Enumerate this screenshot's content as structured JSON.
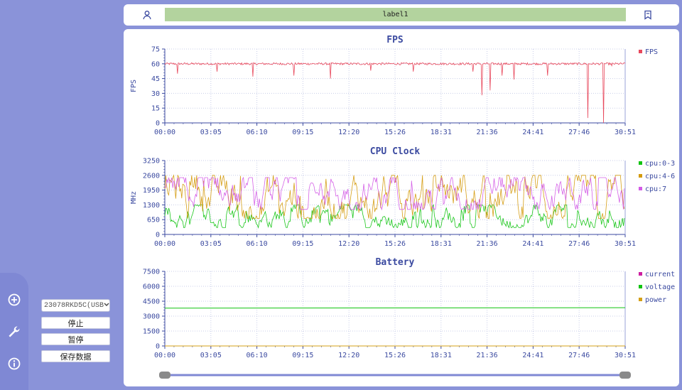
{
  "toolbar": {
    "label": "label1"
  },
  "sidebar": {
    "device": "23078RKD5C(USB",
    "stop": "停止",
    "pause": "暂停",
    "save": "保存数据",
    "icons": [
      "plus-circle-icon",
      "wrench-icon",
      "info-icon"
    ]
  },
  "colors": {
    "background": "#8a93d9",
    "fps": "#e8485c",
    "cpu_0_3": "#10c410",
    "cpu_4_6": "#d49a0c",
    "cpu_7": "#d35be6",
    "current": "#cc1fa0",
    "voltage": "#10c410",
    "power": "#d4a017",
    "title": "#3b4aa0"
  },
  "chart_data": [
    {
      "type": "line",
      "title": "FPS",
      "ylabel": "FPS",
      "ylim": [
        0,
        75
      ],
      "yticks": [
        "0",
        "15",
        "30",
        "45",
        "60",
        "75"
      ],
      "xticks": [
        "00:00",
        "03:05",
        "06:10",
        "09:15",
        "12:20",
        "15:26",
        "18:31",
        "21:36",
        "24:41",
        "27:46",
        "30:51"
      ],
      "xlim_seconds": [
        0,
        1851
      ],
      "grid": true,
      "legend": "right",
      "series": [
        {
          "name": "FPS",
          "baseline": 60,
          "dips": [
            [
              50,
              50
            ],
            [
              210,
              52
            ],
            [
              355,
              47
            ],
            [
              520,
              48
            ],
            [
              665,
              45
            ],
            [
              828,
              53
            ],
            [
              1000,
              52
            ],
            [
              1238,
              52
            ],
            [
              1276,
              28
            ],
            [
              1308,
              33
            ],
            [
              1355,
              48
            ],
            [
              1405,
              44
            ],
            [
              1540,
              48
            ],
            [
              1700,
              5
            ],
            [
              1763,
              0
            ],
            [
              1797,
              58
            ]
          ]
        }
      ]
    },
    {
      "type": "line",
      "title": "CPU Clock",
      "ylabel": "MHz",
      "ylim": [
        0,
        3250
      ],
      "yticks": [
        "0",
        "650",
        "1300",
        "1950",
        "2600",
        "3250"
      ],
      "xticks": [
        "00:00",
        "03:05",
        "06:10",
        "09:15",
        "12:20",
        "15:26",
        "18:31",
        "21:36",
        "24:41",
        "27:46",
        "30:51"
      ],
      "xlim_seconds": [
        0,
        1851
      ],
      "grid": true,
      "legend": "right",
      "series": [
        {
          "name": "cpu:0-3",
          "range": [
            300,
            1300
          ]
        },
        {
          "name": "cpu:4-6",
          "range": [
            700,
            2600
          ]
        },
        {
          "name": "cpu:7",
          "range": [
            1100,
            2500
          ]
        }
      ]
    },
    {
      "type": "line",
      "title": "Battery",
      "ylim": [
        0,
        7500
      ],
      "yticks": [
        "0",
        "1500",
        "3000",
        "4500",
        "6000",
        "7500"
      ],
      "xticks": [
        "00:00",
        "03:05",
        "06:10",
        "09:15",
        "12:20",
        "15:26",
        "18:31",
        "21:36",
        "24:41",
        "27:46",
        "30:51"
      ],
      "xlim_seconds": [
        0,
        1851
      ],
      "grid": true,
      "legend": "right",
      "series": [
        {
          "name": "current",
          "values": [
            0,
            0
          ]
        },
        {
          "name": "voltage",
          "values": [
            3800,
            3850
          ]
        },
        {
          "name": "power",
          "values": [
            0,
            0
          ]
        }
      ]
    }
  ]
}
